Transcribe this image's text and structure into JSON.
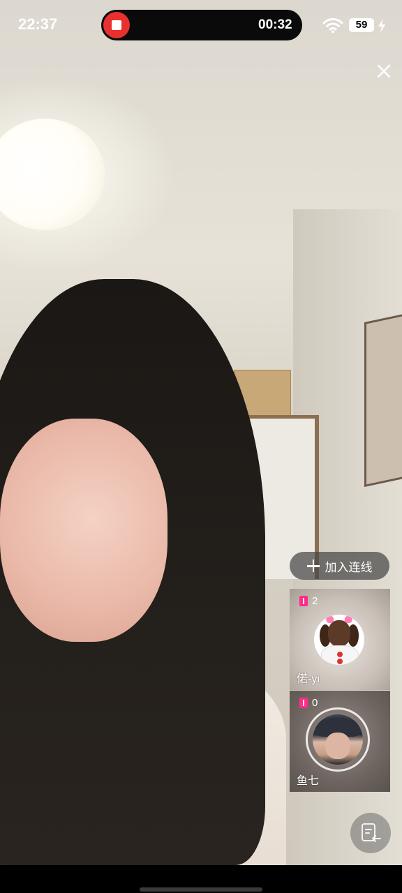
{
  "status_bar": {
    "time": "22:37",
    "recording_timer": "00:32",
    "battery_level": "59",
    "icons": [
      "wifi-icon",
      "battery-icon",
      "charging-bolt-icon"
    ]
  },
  "screen_recording": {
    "stop_icon": "stop-recording-icon"
  },
  "top_actions": {
    "close_icon": "close-icon"
  },
  "join_link": {
    "label": "加入连线",
    "icon": "plus-icon"
  },
  "participants": [
    {
      "heat": "2",
      "name": "偌-yi",
      "avatar": "cartoon-dog-avatar"
    },
    {
      "heat": "0",
      "name": "鱼七",
      "avatar": "boy-cap-avatar"
    }
  ],
  "floating_button": {
    "icon": "exit-document-icon"
  },
  "colors": {
    "record_red": "#e8312f",
    "heat_pink": "#ff2d8a",
    "pill_bg": "#464646"
  }
}
